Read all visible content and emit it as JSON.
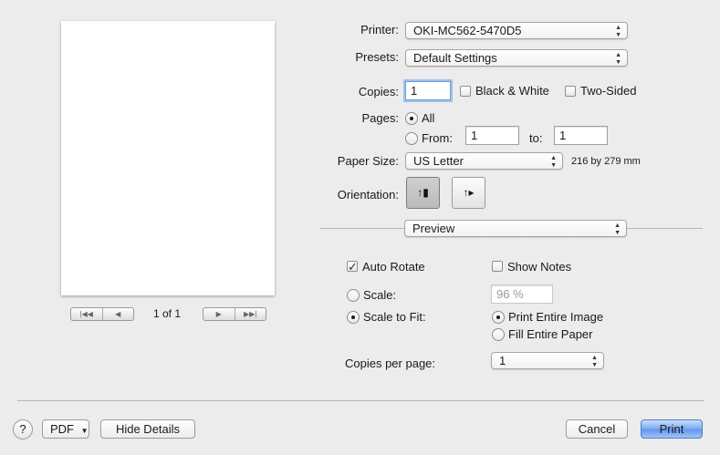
{
  "preview": {
    "page_indicator": "1 of 1",
    "nav_first": "|◀◀",
    "nav_prev": "◀",
    "nav_next": "▶",
    "nav_last": "▶▶|"
  },
  "printer": {
    "label": "Printer:",
    "value": "OKI-MC562-5470D5"
  },
  "presets": {
    "label": "Presets:",
    "value": "Default Settings"
  },
  "copies": {
    "label": "Copies:",
    "value": "1",
    "black_white_label": "Black & White",
    "black_white_checked": false,
    "two_sided_label": "Two-Sided",
    "two_sided_checked": false
  },
  "pages": {
    "label": "Pages:",
    "all_label": "All",
    "from_label": "From:",
    "to_label": "to:",
    "from_value": "1",
    "to_value": "1",
    "selected": "All"
  },
  "paper_size": {
    "label": "Paper Size:",
    "value": "US Letter",
    "dimensions": "216 by 279 mm"
  },
  "orientation": {
    "label": "Orientation:",
    "selected": "portrait",
    "portrait_glyph": "↑▮",
    "landscape_glyph": "↑▸"
  },
  "section": {
    "value": "Preview"
  },
  "preview_options": {
    "auto_rotate_label": "Auto Rotate",
    "auto_rotate_checked": true,
    "show_notes_label": "Show Notes",
    "show_notes_checked": false,
    "scale_label": "Scale:",
    "scale_value": "96 %",
    "scale_to_fit_label": "Scale to Fit:",
    "scale_mode": "Scale to Fit",
    "print_entire_image_label": "Print Entire Image",
    "fill_entire_paper_label": "Fill Entire Paper",
    "fit_option": "Print Entire Image",
    "copies_per_page_label": "Copies per page:",
    "copies_per_page_value": "1"
  },
  "footer": {
    "help": "?",
    "pdf_label": "PDF",
    "hide_details_label": "Hide Details",
    "cancel_label": "Cancel",
    "print_label": "Print"
  },
  "colors": {
    "accent": "#5f95ec",
    "check": "#1e2f5a"
  }
}
